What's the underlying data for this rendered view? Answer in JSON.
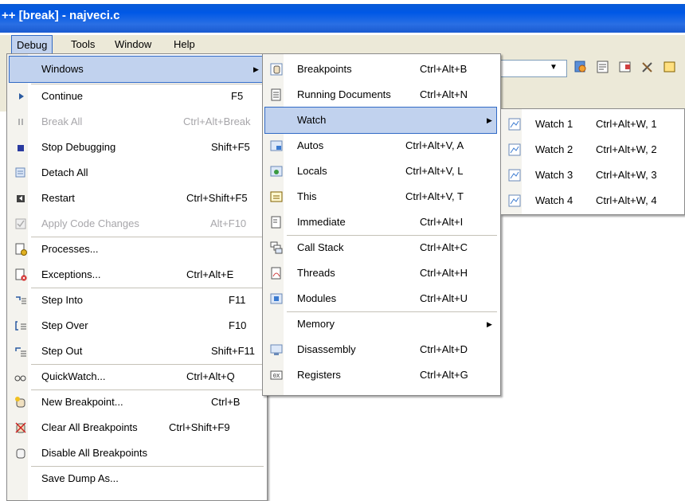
{
  "window": {
    "title": "++ [break] - najveci.c"
  },
  "menubar": {
    "debug": "Debug",
    "tools": "Tools",
    "window": "Window",
    "help": "Help"
  },
  "debug_menu": {
    "items": [
      {
        "label": "Windows",
        "shortcut": ""
      },
      {
        "label": "Continue",
        "shortcut": "F5"
      },
      {
        "label": "Break All",
        "shortcut": "Ctrl+Alt+Break"
      },
      {
        "label": "Stop Debugging",
        "shortcut": "Shift+F5"
      },
      {
        "label": "Detach All",
        "shortcut": ""
      },
      {
        "label": "Restart",
        "shortcut": "Ctrl+Shift+F5"
      },
      {
        "label": "Apply Code Changes",
        "shortcut": "Alt+F10"
      },
      {
        "label": "Processes...",
        "shortcut": ""
      },
      {
        "label": "Exceptions...",
        "shortcut": "Ctrl+Alt+E"
      },
      {
        "label": "Step Into",
        "shortcut": "F11"
      },
      {
        "label": "Step Over",
        "shortcut": "F10"
      },
      {
        "label": "Step Out",
        "shortcut": "Shift+F11"
      },
      {
        "label": "QuickWatch...",
        "shortcut": "Ctrl+Alt+Q"
      },
      {
        "label": "New Breakpoint...",
        "shortcut": "Ctrl+B"
      },
      {
        "label": "Clear All Breakpoints",
        "shortcut": "Ctrl+Shift+F9"
      },
      {
        "label": "Disable All Breakpoints",
        "shortcut": ""
      },
      {
        "label": "Save Dump As...",
        "shortcut": ""
      }
    ]
  },
  "windows_menu": {
    "items": [
      {
        "label": "Breakpoints",
        "shortcut": "Ctrl+Alt+B"
      },
      {
        "label": "Running Documents",
        "shortcut": "Ctrl+Alt+N"
      },
      {
        "label": "Watch",
        "shortcut": ""
      },
      {
        "label": "Autos",
        "shortcut": "Ctrl+Alt+V, A"
      },
      {
        "label": "Locals",
        "shortcut": "Ctrl+Alt+V, L"
      },
      {
        "label": "This",
        "shortcut": "Ctrl+Alt+V, T"
      },
      {
        "label": "Immediate",
        "shortcut": "Ctrl+Alt+I"
      },
      {
        "label": "Call Stack",
        "shortcut": "Ctrl+Alt+C"
      },
      {
        "label": "Threads",
        "shortcut": "Ctrl+Alt+H"
      },
      {
        "label": "Modules",
        "shortcut": "Ctrl+Alt+U"
      },
      {
        "label": "Memory",
        "shortcut": ""
      },
      {
        "label": "Disassembly",
        "shortcut": "Ctrl+Alt+D"
      },
      {
        "label": "Registers",
        "shortcut": "Ctrl+Alt+G"
      }
    ]
  },
  "watch_menu": {
    "items": [
      {
        "label": "Watch 1",
        "shortcut": "Ctrl+Alt+W, 1"
      },
      {
        "label": "Watch 2",
        "shortcut": "Ctrl+Alt+W, 2"
      },
      {
        "label": "Watch 3",
        "shortcut": "Ctrl+Alt+W, 3"
      },
      {
        "label": "Watch 4",
        "shortcut": "Ctrl+Alt+W, 4"
      }
    ]
  },
  "colors": {
    "highlight": "#c1d2ee",
    "highlight_border": "#316ac5",
    "titlebar": "#0058e6",
    "disabled": "#a7a6aa"
  }
}
